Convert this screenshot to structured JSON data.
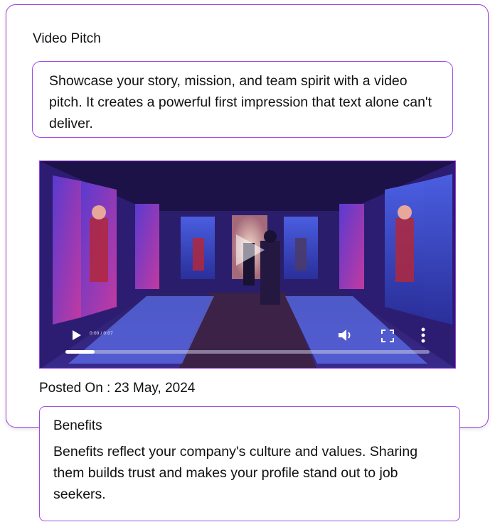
{
  "video_pitch": {
    "title": "Video Pitch",
    "description": "Showcase your story, mission, and team spirit with a video pitch. It creates a powerful first impression that text alone can't deliver.",
    "player": {
      "time": "0:00 / 0:07",
      "progress": 0.08,
      "icons": [
        "play-icon",
        "volume-icon",
        "fullscreen-icon",
        "more-options-icon",
        "big-play-icon"
      ]
    },
    "posted_on": "Posted On : 23 May, 2024"
  },
  "benefits": {
    "title": "Benefits",
    "description": "Benefits reflect your company's culture and values. Sharing them builds trust and makes your profile stand out to job seekers."
  },
  "colors": {
    "accent": "#9b3fe0",
    "video_bg": "#2a1a6e"
  }
}
